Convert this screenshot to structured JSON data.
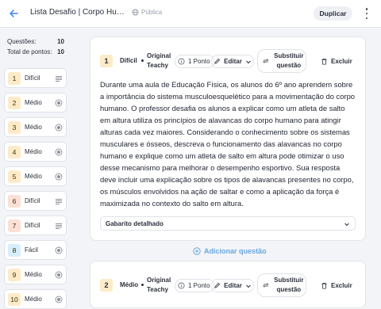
{
  "header": {
    "title": "Lista Desafio | Corpo Humano em Movimento",
    "visibility": "Pública",
    "duplicate_label": "Duplicar"
  },
  "sidebar": {
    "questions_label": "Questões:",
    "questions_count": "10",
    "points_label": "Total de pontos:",
    "points_count": "10",
    "items": [
      {
        "num": "1",
        "level": "Difícil",
        "type": "essay"
      },
      {
        "num": "2",
        "level": "Médio",
        "type": "choice"
      },
      {
        "num": "3",
        "level": "Médio",
        "type": "choice"
      },
      {
        "num": "4",
        "level": "Médio",
        "type": "choice"
      },
      {
        "num": "5",
        "level": "Médio",
        "type": "choice"
      },
      {
        "num": "6",
        "level": "Difícil",
        "type": "essay"
      },
      {
        "num": "7",
        "level": "Difícil",
        "type": "essay"
      },
      {
        "num": "8",
        "level": "Fácil",
        "type": "choice"
      },
      {
        "num": "9",
        "level": "Médio",
        "type": "choice"
      },
      {
        "num": "10",
        "level": "Médio",
        "type": "choice"
      }
    ]
  },
  "questions": [
    {
      "num": "1",
      "difficulty": "Difícil",
      "origin": "Original Teachy",
      "points": "1 Ponto",
      "edit_label": "Editar",
      "replace_label": "Substituir questão",
      "delete_label": "Excluir",
      "text": "Durante uma aula de Educação Física, os alunos do 6º ano aprendem sobre a importância do sistema musculoesquelético para a movimentação do corpo humano. O professor desafia os alunos a explicar como um atleta de salto em altura utiliza os princípios de alavancas do corpo humano para atingir alturas cada vez maiores. Considerando o conhecimento sobre os sistemas musculares e ósseos, descreva o funcionamento das alavancas no corpo humano e explique como um atleta de salto em altura pode otimizar o uso desse mecanismo para melhorar o desempenho esportivo. Sua resposta deve incluir uma explicação sobre os tipos de alavancas presentes no corpo, os músculos envolvidos na ação de saltar e como a aplicação da força é maximizada no contexto do salto em altura.",
      "answer_key_label": "Gabarito detalhado"
    },
    {
      "num": "2",
      "difficulty": "Médio",
      "origin": "Original Teachy",
      "points": "1 Ponto",
      "edit_label": "Editar",
      "replace_label": "Substituir questão",
      "delete_label": "Excluir"
    }
  ],
  "add_question_label": "Adicionar questão",
  "colors": {
    "accent": "#3b82f6",
    "badge_yellow": "#fdebc8",
    "badge_blue": "#d7eefc",
    "badge_pink": "#fbe0d6",
    "add_link": "#6aa7e0"
  }
}
